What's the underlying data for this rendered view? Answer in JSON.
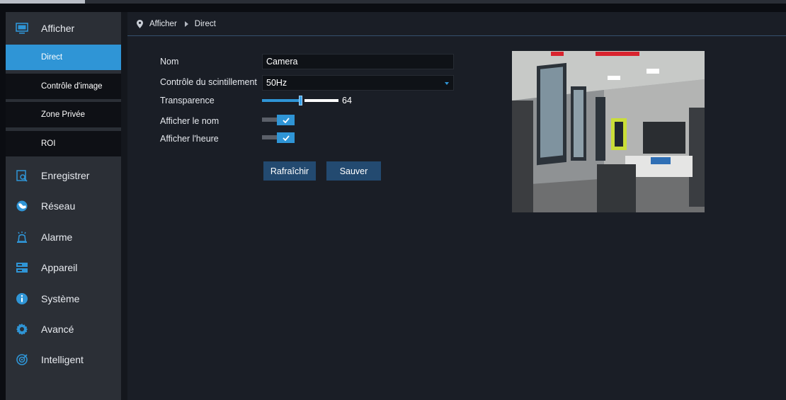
{
  "colors": {
    "accent": "#2f95d6",
    "sidebar_bg": "#2b2f36",
    "main_bg": "#1a1e26",
    "button_bg": "#234a70"
  },
  "sidebar": {
    "top": {
      "label": "Afficher",
      "icon": "monitor-icon"
    },
    "sub_items": [
      {
        "label": "Direct",
        "active": true
      },
      {
        "label": "Contrôle d'image"
      },
      {
        "label": "Zone Privée"
      },
      {
        "label": "ROI"
      }
    ],
    "items": [
      {
        "label": "Enregistrer",
        "icon": "record-search-icon"
      },
      {
        "label": "Réseau",
        "icon": "globe-icon"
      },
      {
        "label": "Alarme",
        "icon": "alarm-siren-icon"
      },
      {
        "label": "Appareil",
        "icon": "storage-device-icon"
      },
      {
        "label": "Système",
        "icon": "info-icon"
      },
      {
        "label": "Avancé",
        "icon": "gear-icon"
      },
      {
        "label": "Intelligent",
        "icon": "intelligent-icon"
      }
    ]
  },
  "breadcrumb": {
    "root": "Afficher",
    "current": "Direct"
  },
  "form": {
    "name": {
      "label": "Nom",
      "value": "Camera"
    },
    "flicker": {
      "label": "Contrôle du scintillement",
      "value": "50Hz"
    },
    "transparency": {
      "label": "Transparence",
      "value": 64,
      "value_text": "64",
      "max": 128
    },
    "show_name": {
      "label": "Afficher le nom",
      "checked": true
    },
    "show_time": {
      "label": "Afficher l'heure",
      "checked": true
    }
  },
  "buttons": {
    "refresh": "Rafraîchir",
    "save": "Sauver"
  },
  "preview": {
    "overlay_icon": "camera-preview-image"
  }
}
